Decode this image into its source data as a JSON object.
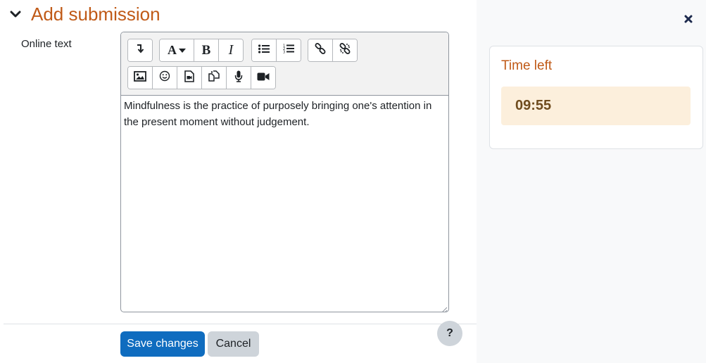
{
  "section": {
    "title": "Add submission",
    "icon": "chevron-down-icon"
  },
  "field": {
    "label": "Online text"
  },
  "editor": {
    "content": "Mindfulness is the practice of purposely bringing one's attention in the present moment without judgement.",
    "toolbar": {
      "row1": [
        "show-more-icon",
        "font-color-icon",
        "bold-icon",
        "italic-icon",
        "unordered-list-icon",
        "ordered-list-icon",
        "link-icon",
        "unlink-icon"
      ],
      "row2": [
        "image-icon",
        "emoji-icon",
        "media-icon",
        "manage-files-icon",
        "record-audio-icon",
        "record-video-icon"
      ]
    }
  },
  "actions": {
    "save_label": "Save changes",
    "cancel_label": "Cancel"
  },
  "help": {
    "label": "?"
  },
  "drawer": {
    "close_icon": "close-icon",
    "timer": {
      "title": "Time left",
      "value": "09:55"
    }
  },
  "colors": {
    "accent": "#c05a17",
    "primary": "#0f6cbf",
    "secondary": "#ced4da",
    "timer_bg": "#fcefdc",
    "timer_text": "#6f4c1e"
  }
}
